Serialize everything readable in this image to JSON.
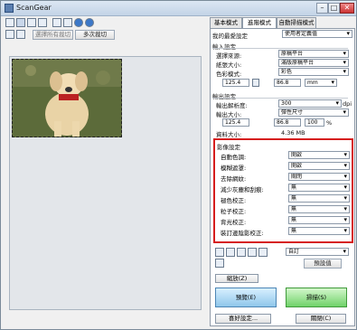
{
  "app": {
    "title": "ScanGear"
  },
  "window_controls": {
    "minimize": "–",
    "maximize": "□",
    "close": "✕"
  },
  "toolbar": {
    "icons": [
      "auto-crop-icon",
      "select-all-icon",
      "rotate-left-icon",
      "rotate-right-icon",
      "thumbnail-icon",
      "clear-icon",
      "info-icon",
      "help-icon"
    ],
    "crop_all_label": "選擇所有裁切",
    "multi_crop_label": "多次裁切"
  },
  "tabs": [
    {
      "label": "基本模式"
    },
    {
      "label": "進階模式"
    },
    {
      "label": "自動掃描模式"
    }
  ],
  "panel": {
    "favorites_label": "我的最愛設定",
    "favorites_value": "使用者定義值",
    "input_section": "輸入設定",
    "input_rows": [
      {
        "label": "選擇來源:",
        "value": "原稿平台"
      },
      {
        "label": "紙張大小:",
        "value": "滿版原稿平台"
      },
      {
        "label": "色彩模式:",
        "value": "彩色"
      }
    ],
    "input_size": {
      "w": "125.4",
      "h": "86.8",
      "unit": "mm"
    },
    "output_section": "輸出設定",
    "output_rows": [
      {
        "label": "輸出解析度:",
        "value": "300",
        "unit": "dpi"
      },
      {
        "label": "輸出大小:",
        "value": "彈性尺寸"
      }
    ],
    "output_size": {
      "w": "125.4",
      "h": "86.8",
      "scale": "100",
      "unit": "%"
    },
    "data_size_label": "資料大小:",
    "data_size_value": "4.36 MB",
    "image_section": "影像設定",
    "image_rows": [
      {
        "label": "自動色調:",
        "value": "開啟"
      },
      {
        "label": "模糊遮罩:",
        "value": "開啟"
      },
      {
        "label": "去除網紋:",
        "value": "關閉"
      },
      {
        "label": "減少灰塵和刮痕:",
        "value": "無"
      },
      {
        "label": "褪色校正:",
        "value": "無"
      },
      {
        "label": "粒子校正:",
        "value": "無"
      },
      {
        "label": "背光校正:",
        "value": "無"
      },
      {
        "label": "裝訂邊陰影校正:",
        "value": "無"
      }
    ],
    "adjust_preset": "自訂",
    "defaults_label": "預設值",
    "zoom_label": "縮放(Z)",
    "preview_label": "預覽(E)",
    "scan_label": "掃描(S)",
    "prefs_label": "喜好設定...",
    "close_label": "關閉(C)"
  }
}
